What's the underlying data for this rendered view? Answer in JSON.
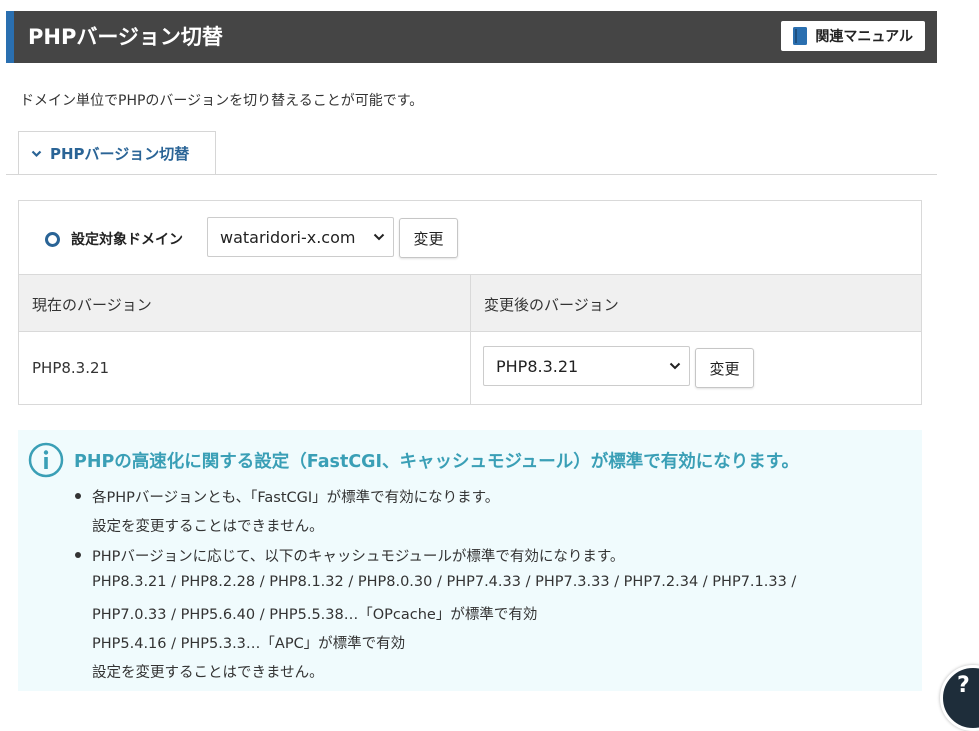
{
  "header": {
    "title": "PHPバージョン切替",
    "manual_label": "関連マニュアル",
    "accent_color": "#2a6fb0"
  },
  "description": "ドメイン単位でPHPのバージョンを切り替えることが可能です。",
  "tab": {
    "label": "PHPバージョン切替"
  },
  "domain_selector": {
    "label": "設定対象ドメイン",
    "selected": "wataridori-x.com",
    "change_label": "変更"
  },
  "table": {
    "headers": [
      "現在のバージョン",
      "変更後のバージョン"
    ],
    "current_version": "PHP8.3.21",
    "new_version_selected": "PHP8.3.21",
    "change_label": "変更"
  },
  "info": {
    "title": "PHPの高速化に関する設定（FastCGI、キャッシュモジュール）が標準で有効になります。",
    "items": [
      {
        "lines": [
          "各PHPバージョンとも、「FastCGI」が標準で有効になります。",
          "設定を変更することはできません。"
        ]
      },
      {
        "lines": [
          "PHPバージョンに応じて、以下のキャッシュモジュールが標準で有効になります。",
          "PHP8.3.21 / PHP8.2.28 / PHP8.1.32 / PHP8.0.30 / PHP7.4.33 / PHP7.3.33 / PHP7.2.34 / PHP7.1.33 /",
          "PHP7.0.33 / PHP5.6.40 / PHP5.5.38…「OPcache」が標準で有効",
          "PHP5.4.16 / PHP5.3.3…「APC」が標準で有効",
          "設定を変更することはできません。"
        ]
      }
    ]
  },
  "help": {
    "icon": "question-icon",
    "label": "?"
  }
}
